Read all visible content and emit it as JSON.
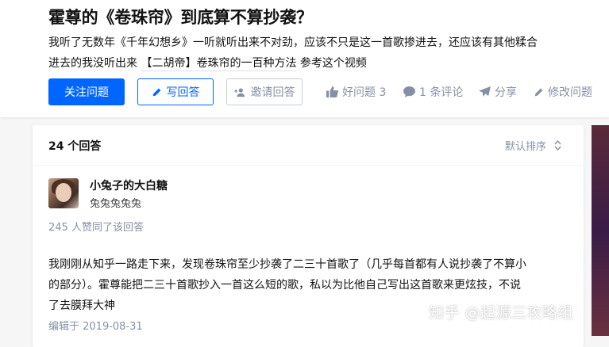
{
  "question": {
    "title": "霍尊的《卷珠帘》到底算不算抄袭？",
    "detail_line1": "我听了无数年《千年幻想乡》一听就听出来不对劲，应该不只是这一首歌掺进去，还应该有其他糅合",
    "detail_line2_prefix": "进去的我没听出来",
    "detail_link": "【二胡帝】卷珠帘的一百种方法",
    "detail_line2_suffix": "参考这个视频"
  },
  "actions": {
    "follow": "关注问题",
    "write": "写回答",
    "invite": "邀请回答",
    "upvote": "好问题 3",
    "comment": "1 条评论",
    "share": "分享",
    "edit": "修改问题"
  },
  "answers": {
    "count_label": "24 个回答",
    "sort_label": "默认排序"
  },
  "answer": {
    "author_name": "小兔子的大白糖",
    "author_bio": "兔兔兔兔兔",
    "votes_label": "245 人赞同了该回答",
    "content_line1": "我刚刚从知乎一路走下来，发现卷珠帘至少抄袭了二三十首歌了（几乎每首都有人说抄袭了不算小",
    "content_line2": "的部分）。霍尊能把二三十首歌抄入一首这么短的歌，私以为比他自己写出这首歌来更炫技，不说",
    "content_line3": "了去膜拜大神",
    "edited": "编辑于 2019-08-31"
  },
  "watermark": "知乎 @起源三攻略组",
  "colors": {
    "brand_blue": "#0066ff",
    "muted_gray": "#8590a6",
    "text": "#121212",
    "page_bg": "#f6f6f6"
  },
  "icons": {
    "write": "pencil-icon",
    "invite": "add-user-icon",
    "upvote": "thumbs-up-icon",
    "comment": "comment-bubble-icon",
    "share": "paper-plane-icon",
    "edit": "pencil-icon",
    "sort": "sort-arrows-icon"
  }
}
